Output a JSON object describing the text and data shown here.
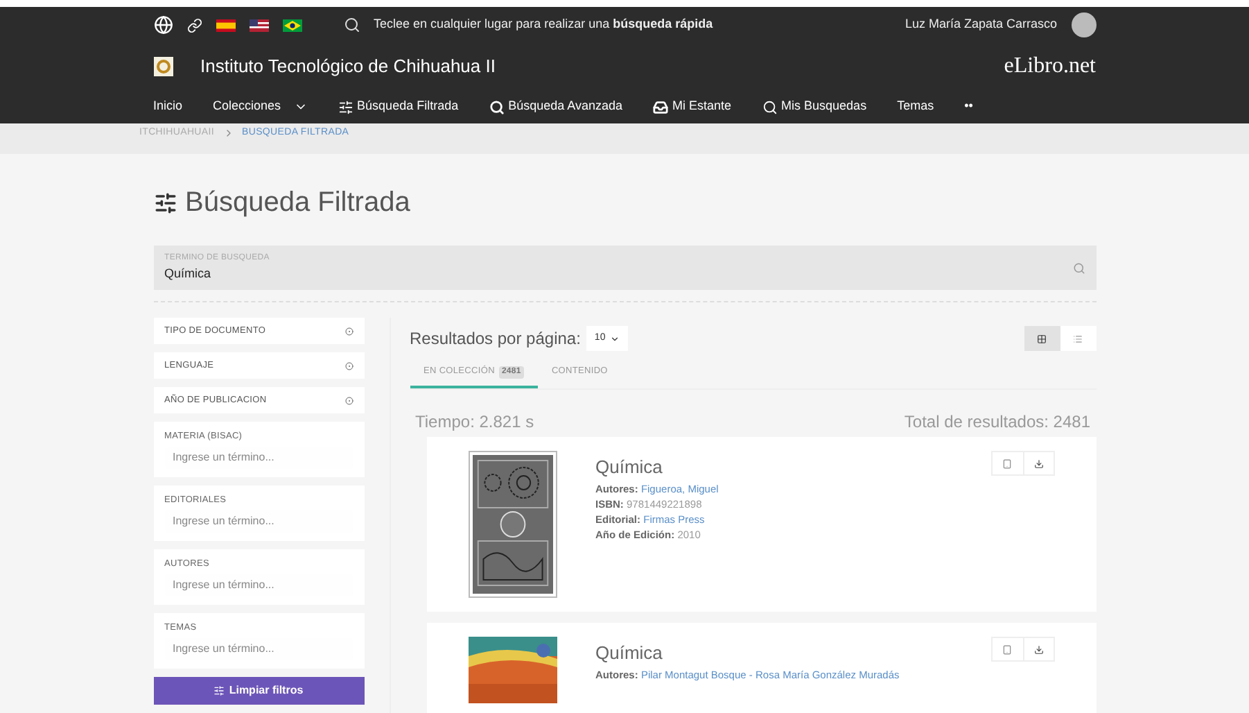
{
  "topbar": {
    "flags": [
      {
        "kind": "globe"
      },
      {
        "kind": "link"
      },
      {
        "kind": "spain"
      },
      {
        "kind": "usa"
      },
      {
        "kind": "brazil"
      }
    ],
    "quick_search": "Teclee en cualquier lugar para realizar una **búsqueda rápida**",
    "user": "Luz María Zapata Carrasco"
  },
  "brand": {
    "institution": "Instituto Tecnológico de Chihuahua II",
    "logo": "eLibro.net"
  },
  "nav": [
    {
      "label": "Inicio",
      "kind": "plain"
    },
    {
      "label": "Colecciones",
      "kind": "menu"
    },
    {
      "label": "Búsqueda Filtrada",
      "kind": "filter"
    },
    {
      "label": "Búsqueda Avanzada",
      "kind": "advanced"
    },
    {
      "label": "Mi Estante",
      "kind": "shelf"
    },
    {
      "label": "Mis Busquedas",
      "kind": "saved"
    },
    {
      "label": "Temas",
      "kind": "plain"
    },
    {
      "label": "••",
      "kind": "plain"
    }
  ],
  "breadcrumb": [
    {
      "label": "ITCHIHUAHUAII",
      "current": false
    },
    {
      "label": "BUSQUEDA FILTRADA",
      "current": true
    }
  ],
  "page_title": "Búsqueda Filtrada",
  "search": {
    "label": "TERMINO DE BUSQUEDA",
    "value": "Química"
  },
  "filters": [
    {
      "kind": "dropdown",
      "label": "TIPO DE DOCUMENTO"
    },
    {
      "kind": "dropdown",
      "label": "LENGUAJE"
    },
    {
      "kind": "dropdown",
      "label": "AÑO DE PUBLICACION"
    },
    {
      "kind": "input",
      "label": "MATERIA (BISAC)",
      "placeholder": "Ingrese un término..."
    },
    {
      "kind": "input",
      "label": "EDITORIALES",
      "placeholder": "Ingrese un término..."
    },
    {
      "kind": "input",
      "label": "AUTORES",
      "placeholder": "Ingrese un término..."
    },
    {
      "kind": "input",
      "label": "TEMAS",
      "placeholder": "Ingrese un término..."
    }
  ],
  "clear_button": "Limpiar filtros",
  "results": {
    "per_page_label": "Resultados por página:",
    "per_page_value": "10",
    "views": [
      {
        "kind": "grid",
        "selected": true
      },
      {
        "kind": "list",
        "selected": false
      }
    ],
    "tabs": [
      {
        "label": "EN COLECCIÓN",
        "count": "2481",
        "selected": true
      },
      {
        "label": "CONTENIDO",
        "selected": false
      }
    ],
    "time": "Tiempo: 2.821 s",
    "total": "Total de resultados: 2481",
    "books": [
      {
        "title": "Química",
        "fields": [
          {
            "label": "Autores:",
            "value": "Figueroa, Miguel",
            "kind": "link"
          },
          {
            "label": "ISBN:",
            "value": "9781449221898",
            "kind": "plain"
          },
          {
            "label": "Editorial:",
            "value": "Firmas Press",
            "kind": "link"
          },
          {
            "label": "Año de Edición:",
            "value": "2010",
            "kind": "plain"
          }
        ]
      },
      {
        "title": "Química",
        "fields": [
          {
            "label": "Autores:",
            "value": "Pilar Montagut Bosque - Rosa María González Muradás",
            "kind": "link"
          }
        ]
      }
    ]
  }
}
